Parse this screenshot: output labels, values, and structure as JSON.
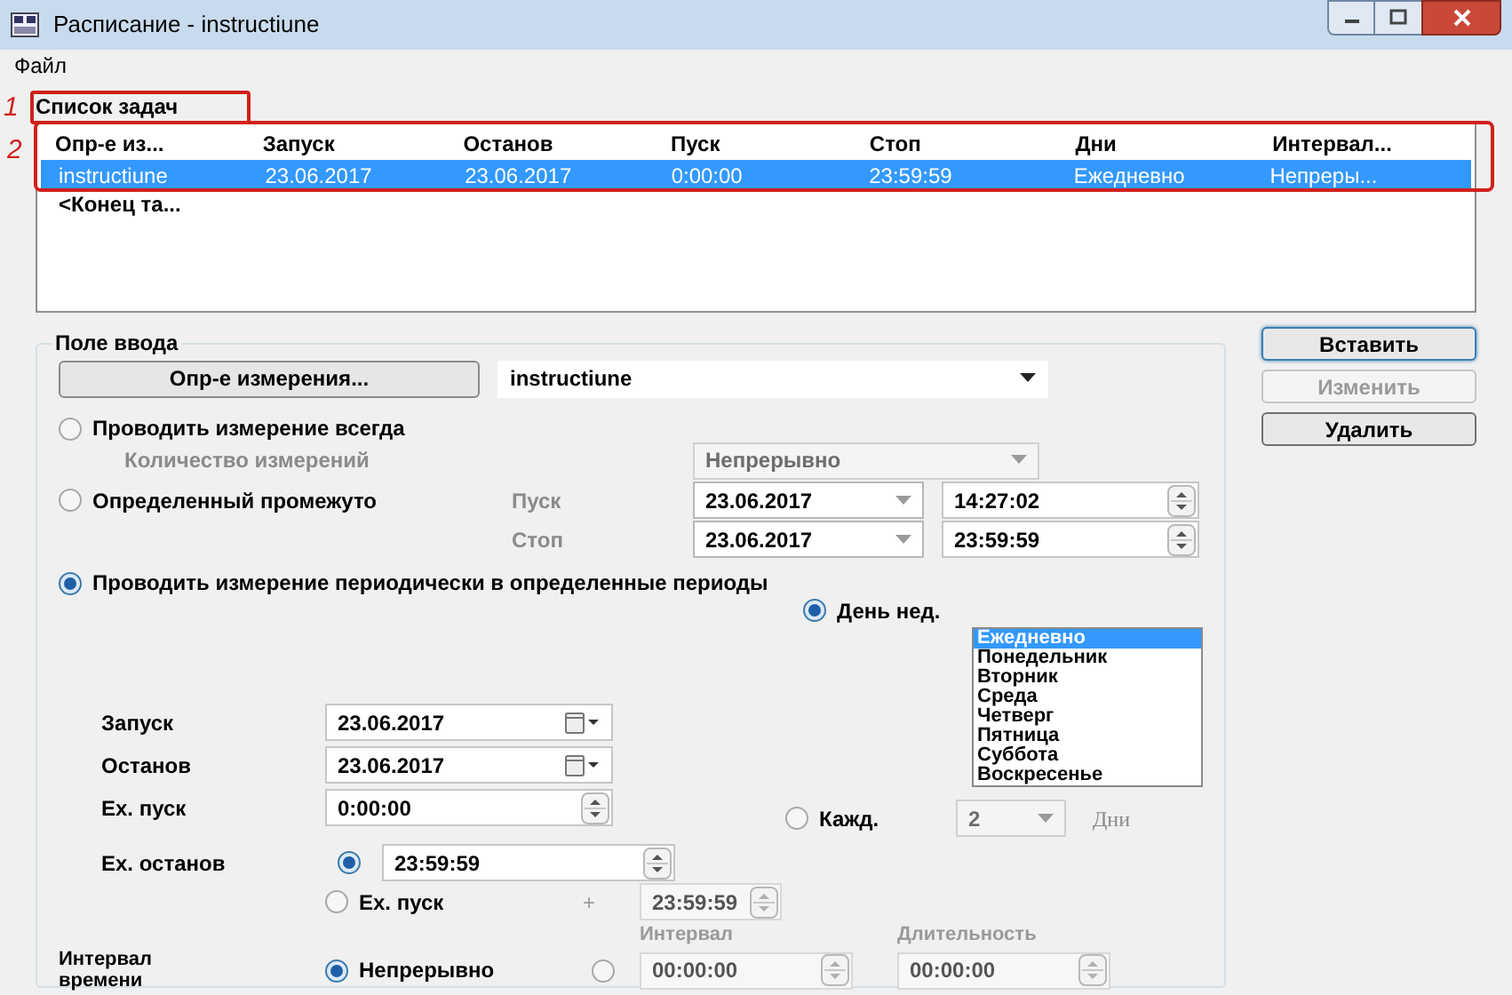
{
  "window": {
    "title": "Расписание - instructiune"
  },
  "menu": [
    {
      "label": "Файл"
    }
  ],
  "annotations": [
    {
      "label": "1"
    },
    {
      "label": "2"
    }
  ],
  "task_list": {
    "title": "Список задач",
    "columns": [
      "Опр-е из...",
      "Запуск",
      "Останов",
      "Пуск",
      "Стоп",
      "Дни",
      "Интервал..."
    ],
    "rows": [
      {
        "cells": [
          "instructiune",
          "23.06.2017",
          "23.06.2017",
          "0:00:00",
          "23:59:59",
          "Ежедневно",
          "Непреры..."
        ],
        "selected": true
      }
    ],
    "footer": "<Конец та..."
  },
  "input_group": {
    "title": "Поле ввода",
    "measure_button": "Опр-е измерения...",
    "measure_value": "instructiune",
    "always": {
      "label": "Проводить измерение всегда",
      "selected": false,
      "count_label": "Количество измерений",
      "count_value": "Непрерывно"
    },
    "range": {
      "label": "Определенный промежуто",
      "selected": false,
      "start_label": "Пуск",
      "start_date": "23.06.2017",
      "start_time": "14:27:02",
      "stop_label": "Стоп",
      "stop_date": "23.06.2017",
      "stop_time": "23:59:59"
    },
    "periodic": {
      "label": "Проводить измерение периодически в определенные периоды",
      "selected": true,
      "weekday": {
        "label": "День нед.",
        "selected": true,
        "days": [
          {
            "label": "Ежедневно",
            "selected": true
          },
          {
            "label": "Понедельник",
            "selected": false
          },
          {
            "label": "Вторник",
            "selected": false
          },
          {
            "label": "Среда",
            "selected": false
          },
          {
            "label": "Четверг",
            "selected": false
          },
          {
            "label": "Пятница",
            "selected": false
          },
          {
            "label": "Суббота",
            "selected": false
          },
          {
            "label": "Воскресенье",
            "selected": false
          }
        ]
      },
      "every": {
        "label": "Кажд.",
        "selected": false,
        "value": "2",
        "unit": "Дни"
      },
      "start_label": "Запуск",
      "start_date": "23.06.2017",
      "stop_label": "Останов",
      "stop_date": "23.06.2017",
      "daily_start_label": "Ех. пуск",
      "daily_start_time": "0:00:00",
      "daily_stop_label": "Ех. останов",
      "daily_stop": {
        "selected": true,
        "time": "23:59:59"
      },
      "daily_offset": {
        "label": "Ех. пуск",
        "selected": false,
        "sign": "+",
        "time": "23:59:59"
      },
      "time_interval": {
        "label": "Интервал времени",
        "continuous": {
          "label": "Непрерывно",
          "selected": true
        },
        "custom": {
          "selected": false,
          "interval_label": "Интервал",
          "interval": "00:00:00",
          "duration_label": "Длительность",
          "duration": "00:00:00"
        }
      }
    }
  },
  "buttons": [
    {
      "label": "Вставить",
      "disabled": false,
      "default": true
    },
    {
      "label": "Изменить",
      "disabled": true,
      "default": false
    },
    {
      "label": "Удалить",
      "disabled": false,
      "default": false
    }
  ]
}
